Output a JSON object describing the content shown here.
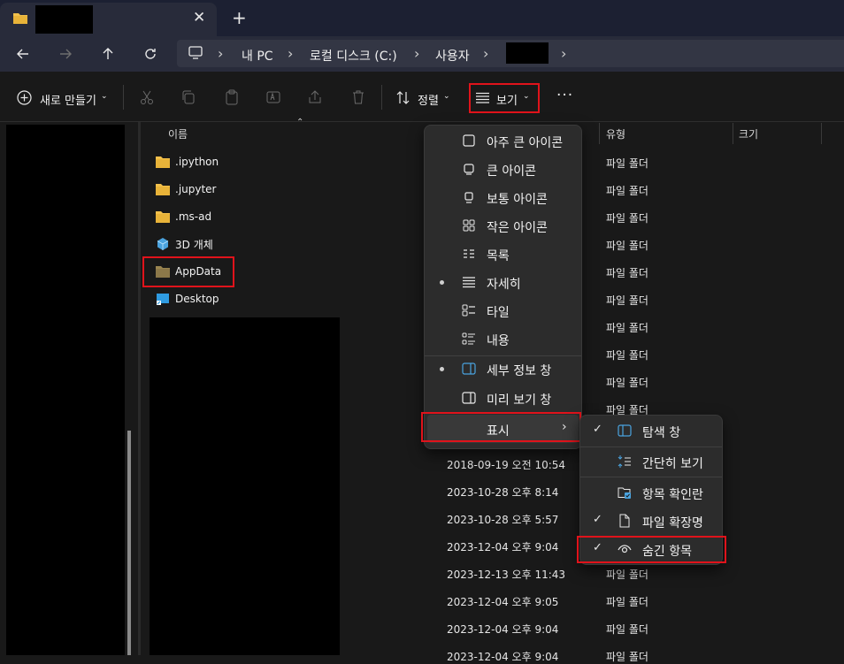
{
  "window": {
    "new_tab": "+",
    "close": "✕"
  },
  "breadcrumb": [
    "내 PC",
    "로컬 디스크 (C:)",
    "사용자"
  ],
  "toolbar": {
    "new_label": "새로 만들기",
    "sort_label": "정렬",
    "view_label": "보기",
    "more": "···"
  },
  "columns": {
    "name": "이름",
    "type": "유형",
    "size": "크기"
  },
  "files": [
    {
      "name": ".ipython",
      "icon": "folder-icon"
    },
    {
      "name": ".jupyter",
      "icon": "folder-icon"
    },
    {
      "name": ".ms-ad",
      "icon": "folder-icon"
    },
    {
      "name": "3D 개체",
      "icon": "3d-objects-icon"
    },
    {
      "name": "AppData",
      "icon": "folder-hidden-icon"
    },
    {
      "name": "Desktop",
      "icon": "desktop-icon"
    }
  ],
  "types": [
    "파일 폴더",
    "파일 폴더",
    "파일 폴더",
    "파일 폴더",
    "파일 폴더",
    "파일 폴더",
    "파일 폴더",
    "파일 폴더",
    "파일 폴더",
    "파일 폴더",
    "파일 폴더",
    "파일 폴더",
    "파일 폴더",
    "파일 폴더",
    "파일 폴더",
    "파일 폴더",
    "파일 폴더",
    "파일 폴더",
    "파일 폴더"
  ],
  "dates": [
    "2018-09-19 오전 10:54",
    "2023-10-28 오후 8:14",
    "2023-10-28 오후 5:57",
    "2023-12-04 오후 9:04",
    "2023-12-13 오후 11:43",
    "2023-12-04 오후 9:05",
    "2023-12-04 오후 9:04",
    "2023-12-04 오후 9:04"
  ],
  "view_menu": {
    "items": [
      "아주 큰 아이콘",
      "큰 아이콘",
      "보통 아이콘",
      "작은 아이콘",
      "목록",
      "자세히",
      "타일",
      "내용"
    ],
    "panes": [
      "세부 정보 창",
      "미리 보기 창"
    ],
    "show": "표시",
    "selected_layout": "자세히",
    "selected_pane": "세부 정보 창"
  },
  "show_submenu": {
    "items": [
      "탐색 창",
      "간단히 보기",
      "항목 확인란",
      "파일 확장명",
      "숨긴 항목"
    ],
    "checked": [
      true,
      false,
      false,
      true,
      true
    ],
    "check_mark": "✓"
  },
  "colors": {
    "highlight_box": "#e0131b",
    "folder": "#e8b339"
  }
}
